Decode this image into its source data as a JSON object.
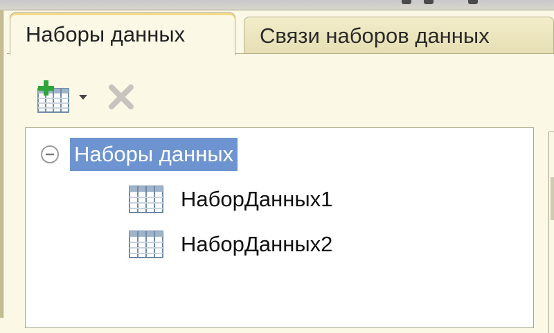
{
  "tabs": [
    {
      "label": "Наборы данных",
      "active": true
    },
    {
      "label": "Связи наборов данных",
      "active": false
    }
  ],
  "toolbar": {
    "add_icon": "add-table-icon",
    "add_dropdown_icon": "chevron-down-icon",
    "delete_icon": "delete-icon"
  },
  "tree": {
    "root": {
      "label": "Наборы данных",
      "expanded": true,
      "selected": true,
      "icon": "collapse-icon"
    },
    "items": [
      {
        "label": "НаборДанных1",
        "icon": "table-icon"
      },
      {
        "label": "НаборДанных2",
        "icon": "table-icon"
      }
    ]
  },
  "colors": {
    "background": "#fbf8e6",
    "selection": "#6d94d0",
    "accent_green": "#2fa43a",
    "delete_gray": "#c9c3be"
  }
}
